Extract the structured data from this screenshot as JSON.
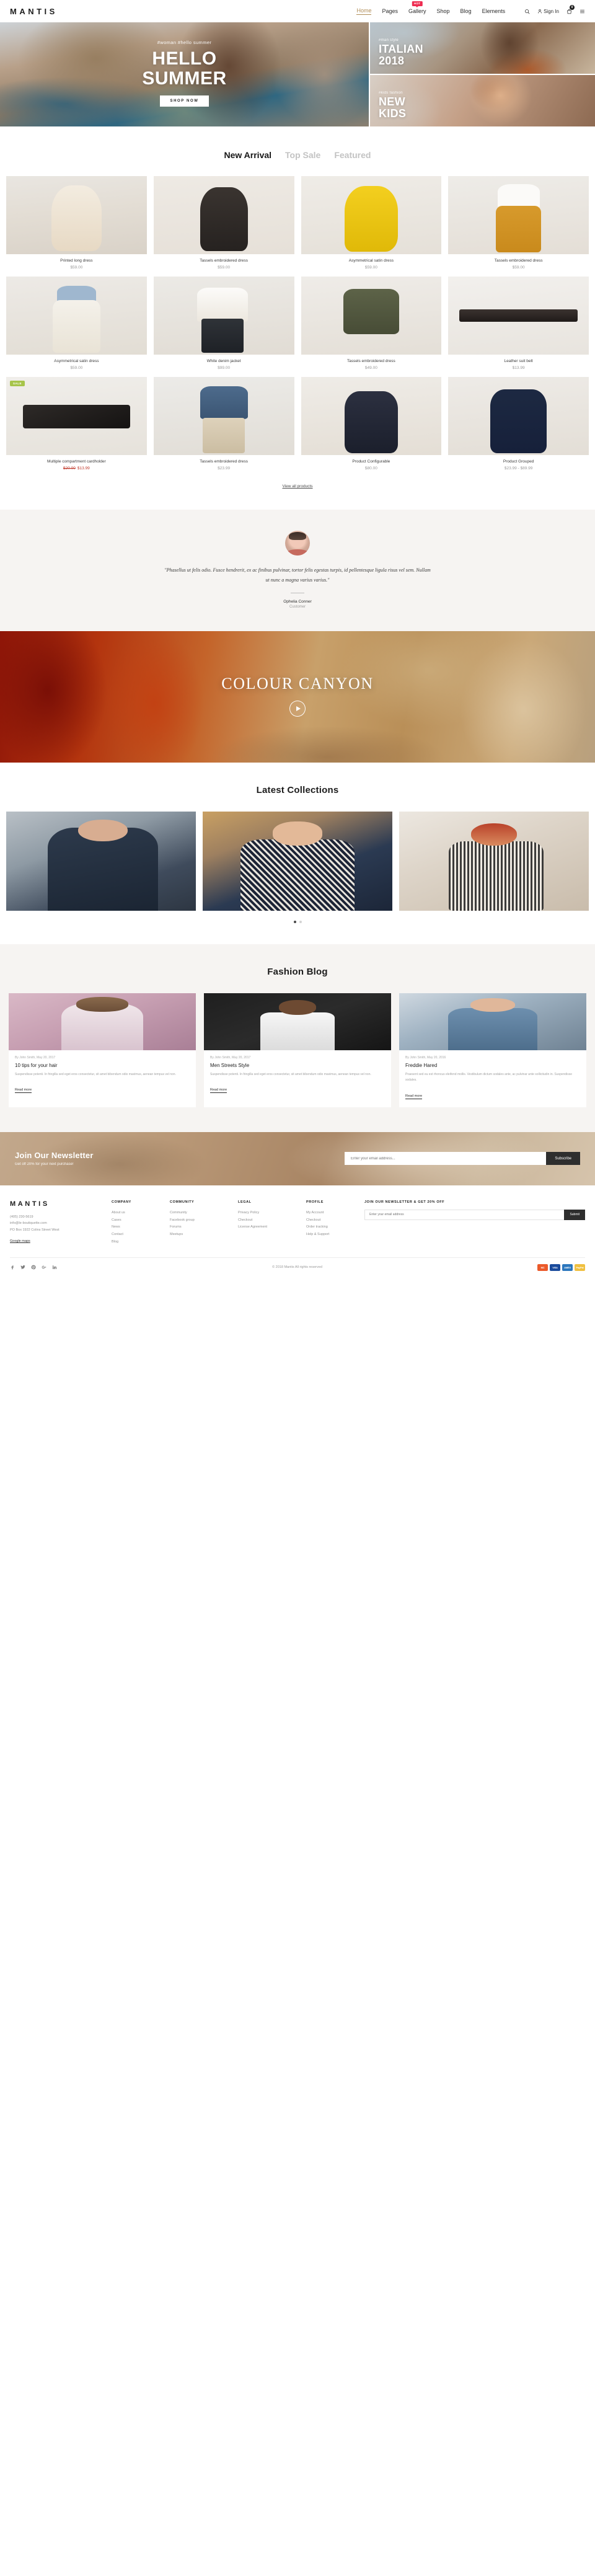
{
  "header": {
    "logo": "MANTIS",
    "nav": [
      {
        "label": "Home",
        "active": true,
        "badge": ""
      },
      {
        "label": "Pages",
        "active": false,
        "badge": ""
      },
      {
        "label": "Gallery",
        "active": false,
        "badge": "HOT"
      },
      {
        "label": "Shop",
        "active": false,
        "badge": ""
      },
      {
        "label": "Blog",
        "active": false,
        "badge": ""
      },
      {
        "label": "Elements",
        "active": false,
        "badge": ""
      }
    ],
    "signin_label": "Sign In",
    "cart_count": "0"
  },
  "hero": {
    "main": {
      "tagline": "#woman #hello summer",
      "title_line1": "HELLO",
      "title_line2": "SUMMER",
      "button": "SHOP NOW"
    },
    "top_right": {
      "tagline": "#man style",
      "title_line1": "ITALIAN",
      "title_line2": "2018"
    },
    "bottom_right": {
      "tagline": "#kids fashion",
      "title_line1": "NEW",
      "title_line2": "KIDS"
    }
  },
  "arrivals": {
    "tabs": [
      {
        "label": "New Arrival",
        "active": true
      },
      {
        "label": "Top Sale",
        "active": false
      },
      {
        "label": "Featured",
        "active": false
      }
    ],
    "view_all": "View all products",
    "products": [
      {
        "name": "Printed long dress",
        "price": "$59.00",
        "old_price": "",
        "badge": "",
        "art": "a1"
      },
      {
        "name": "Tassels embroidered dress",
        "price": "$59.00",
        "old_price": "",
        "badge": "",
        "art": "a2"
      },
      {
        "name": "Asymmetrical satin dress",
        "price": "$59.00",
        "old_price": "",
        "badge": "",
        "art": "a3"
      },
      {
        "name": "Tassels embroidered dress",
        "price": "$59.00",
        "old_price": "",
        "badge": "",
        "art": "a4"
      },
      {
        "name": "Asymmetrical satin dress",
        "price": "$59.00",
        "old_price": "",
        "badge": "",
        "art": "a5"
      },
      {
        "name": "White denim jacket",
        "price": "$99.00",
        "old_price": "",
        "badge": "",
        "art": "a6"
      },
      {
        "name": "Tassels embroidered dress",
        "price": "$49.00",
        "old_price": "",
        "badge": "",
        "art": "a7"
      },
      {
        "name": "Leather suit belt",
        "price": "$13.99",
        "old_price": "",
        "badge": "",
        "art": "a8"
      },
      {
        "name": "Multiple compartment cardholder",
        "price": "$13.99",
        "old_price": "$20.00",
        "badge": "SALE",
        "art": "a9"
      },
      {
        "name": "Tassels embroidered dress",
        "price": "$23.99",
        "old_price": "",
        "badge": "",
        "art": "a10"
      },
      {
        "name": "Product Configurable",
        "price": "$80.00",
        "old_price": "",
        "badge": "",
        "art": "a11"
      },
      {
        "name": "Product Grouped",
        "price": "$23.99 - $89.99",
        "old_price": "",
        "badge": "",
        "art": "a12"
      }
    ]
  },
  "testimonial": {
    "quote": "\"Phasellus ut felis odio. Fusce hendrerit, ex ac finibus pulvinar, tortor felis egestas turpis, id pellentesque ligula risus vel sem. Nullam ut nunc a magna varius varius.\"",
    "name": "Ophelia Conner",
    "role": "Customer"
  },
  "canyon": {
    "title": "COLOUR CANYON"
  },
  "collections": {
    "title": "Latest Collections",
    "items": [
      {
        "art": "c1"
      },
      {
        "art": "c2"
      },
      {
        "art": "c3"
      }
    ],
    "dots": [
      true,
      false
    ]
  },
  "blog": {
    "title": "Fashion Blog",
    "posts": [
      {
        "meta": "By John Smith, May 20, 2017",
        "title": "10 tips for your hair",
        "excerpt": "Suspendisse potenti. In fringilla sed eget eros consectetur, sit amet bibendum odio maximus, aenean tempus vel non.",
        "more": "Read more",
        "art": "b1"
      },
      {
        "meta": "By John Smith, May 20, 2017",
        "title": "Men Streets Style",
        "excerpt": "Suspendisse potenti. In fringilla sed eget eros consectetur, sit amet bibendum odio maximus, aenean tempus vel non.",
        "more": "Read more",
        "art": "b2"
      },
      {
        "meta": "By John Smith, May 20, 2016",
        "title": "Freddie Hared",
        "excerpt": "Praesent sed eu est rhoncus eleifend mollis. Vestibulum dictum sodales ante, ac pulvinar ante sollicitudin in. Suspendisse sodales.",
        "more": "Read more",
        "art": "b3"
      }
    ]
  },
  "newsletter": {
    "title": "Join Our Newsletter",
    "subtitle": "Get off 20% for your next purchase!",
    "placeholder": "Enter your email address...",
    "button": "Subscribe"
  },
  "footer": {
    "logo": "MANTIS",
    "phone": "(405) 230-5619",
    "email": "info@le-boutiquette.com",
    "address": "PO Box 1922 Colins Street West",
    "map_link": "Google maps",
    "columns": [
      {
        "head": "COMPANY",
        "items": [
          "About us",
          "Cases",
          "News",
          "Contact",
          "Blog"
        ]
      },
      {
        "head": "COMMUNITY",
        "items": [
          "Community",
          "Facebook group",
          "Forums",
          "Meetups"
        ]
      },
      {
        "head": "LEGAL",
        "items": [
          "Privacy Policy",
          "Checkout",
          "License Agreement"
        ]
      },
      {
        "head": "PROFILE",
        "items": [
          "My Account",
          "Checkout",
          "Order tracking",
          "Help & Support"
        ]
      }
    ],
    "newsletter_head": "JOIN OUR NEWSLETTER & GET 20% OFF",
    "newsletter_placeholder": "Enter your email address",
    "newsletter_button": "Submit",
    "socials": [
      "facebook-icon",
      "twitter-icon",
      "pinterest-icon",
      "google-plus-icon",
      "linkedin-icon"
    ],
    "copyright": "© 2018 Mantis All rights reserved",
    "cards": [
      {
        "label": "MC",
        "color": "#eb5a2a"
      },
      {
        "label": "VISA",
        "color": "#1a4b9c"
      },
      {
        "label": "AMEX",
        "color": "#2c77bd"
      },
      {
        "label": "PayPal",
        "color": "#f0c040"
      }
    ]
  }
}
